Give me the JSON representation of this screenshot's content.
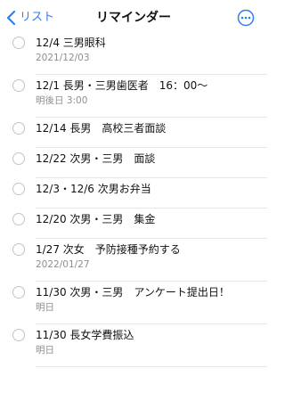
{
  "nav": {
    "back_label": "リスト",
    "title": "リマインダー",
    "accent_color": "#2f7cf6"
  },
  "items": [
    {
      "title": "12/4 三男眼科",
      "subtitle": "2021/12/03"
    },
    {
      "title": "12/1 長男・三男歯医者　16：00～",
      "subtitle": "明後日 3:00"
    },
    {
      "title": "12/14 長男　高校三者面談",
      "subtitle": ""
    },
    {
      "title": "12/22 次男・三男　面談",
      "subtitle": ""
    },
    {
      "title": "12/3・12/6 次男お弁当",
      "subtitle": ""
    },
    {
      "title": "12/20 次男・三男　集金",
      "subtitle": ""
    },
    {
      "title": "1/27 次女　予防接種予約する",
      "subtitle": "2022/01/27"
    },
    {
      "title": "11/30 次男・三男　アンケート提出日！",
      "subtitle": "明日"
    },
    {
      "title": "11/30 長女学費振込",
      "subtitle": "明日"
    }
  ]
}
